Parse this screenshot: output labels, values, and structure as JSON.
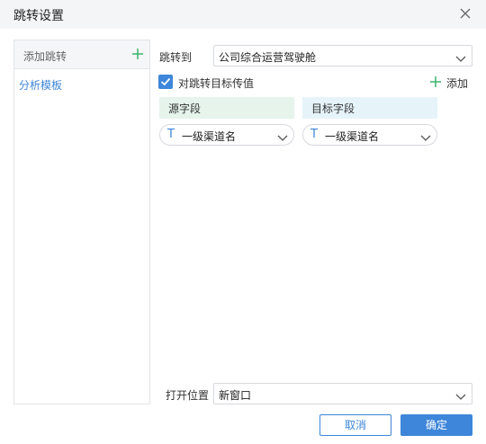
{
  "dialog": {
    "title": "跳转设置"
  },
  "sidebar": {
    "header_label": "添加跳转",
    "items": [
      {
        "label": "分析模板"
      }
    ]
  },
  "jump_to": {
    "label": "跳转到",
    "value": "公司综合运营驾驶舱"
  },
  "pass_value": {
    "label": "对跳转目标传值",
    "checked": true
  },
  "add_field": {
    "label": "添加"
  },
  "mapping": {
    "source_header": "源字段",
    "target_header": "目标字段",
    "rows": [
      {
        "source": "一级渠道名",
        "target": "一级渠道名",
        "type_icon": "T"
      }
    ]
  },
  "open_position": {
    "label": "打开位置",
    "value": "新窗口"
  },
  "buttons": {
    "cancel": "取消",
    "confirm": "确定"
  },
  "colors": {
    "accent": "#3d86d9",
    "add_green": "#3cb46e"
  }
}
